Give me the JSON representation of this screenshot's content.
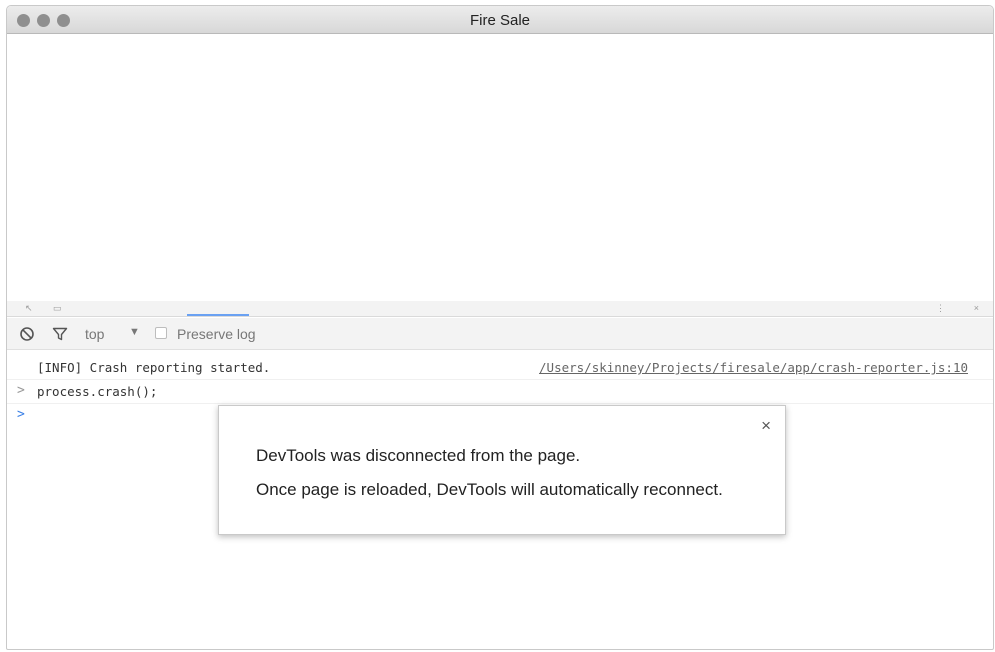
{
  "window": {
    "title": "Fire Sale"
  },
  "devtools": {
    "context": "top",
    "preserve_log_label": "Preserve log"
  },
  "console": {
    "lines": [
      {
        "message": "[INFO] Crash reporting started.",
        "source": "/Users/skinney/Projects/firesale/app/crash-reporter.js:10"
      },
      {
        "prompt": ">",
        "message": "process.crash();"
      },
      {
        "prompt": ">",
        "message": ""
      }
    ]
  },
  "dialog": {
    "line1": "DevTools was disconnected from the page.",
    "line2": "Once page is reloaded, DevTools will automatically reconnect.",
    "close_glyph": "×"
  },
  "icons": {
    "clear": "clear-console-icon",
    "filter": "filter-icon",
    "dropdown": "dropdown-arrow-icon"
  },
  "colors": {
    "titlebar": "#dcdcdc",
    "prompt_active": "#3b80e6",
    "tab_active_underline": "#6aa1f2"
  }
}
